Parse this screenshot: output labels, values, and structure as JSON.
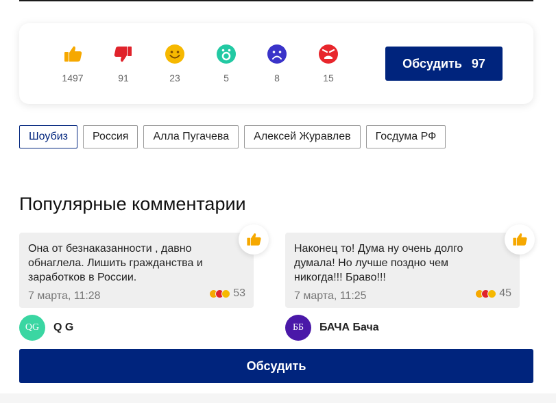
{
  "reactions": [
    {
      "name": "like",
      "icon": "thumbs-up-icon",
      "count": "1497",
      "color": "#f6a800"
    },
    {
      "name": "dislike",
      "icon": "thumbs-down-icon",
      "count": "91",
      "color": "#e0232b"
    },
    {
      "name": "smile",
      "icon": "smile-icon",
      "count": "23",
      "color": "#f6b800"
    },
    {
      "name": "surprise",
      "icon": "surprised-icon",
      "count": "5",
      "color": "#22c9a3"
    },
    {
      "name": "sad",
      "icon": "sad-icon",
      "count": "8",
      "color": "#3a33c9"
    },
    {
      "name": "angry",
      "icon": "angry-icon",
      "count": "15",
      "color": "#e8262c"
    }
  ],
  "discuss_top": {
    "label": "Обсудить",
    "count": "97"
  },
  "tags": [
    "Шоубиз",
    "Россия",
    "Алла Пугачева",
    "Алексей Журавлев",
    "Госдума РФ"
  ],
  "section_title": "Популярные комментарии",
  "comments": [
    {
      "text": "Она от безнаказанности , давно обнаглела. Лишить гражданства и заработков в России.",
      "date": "7 марта, 11:28",
      "score": "53",
      "author": "Q G",
      "initials": "QG",
      "avatar_color": "#3ad6a2"
    },
    {
      "text": "Наконец то! Дума ну очень долго думала! Но лучше поздно чем никогда!!! Браво!!!",
      "date": "7 марта, 11:25",
      "score": "45",
      "author": "БАЧА Бача",
      "initials": "ББ",
      "avatar_color": "#4a18a8"
    }
  ],
  "discuss_bottom": {
    "label": "Обсудить"
  },
  "colors": {
    "brand": "#00247d",
    "card_bg": "#efefef"
  }
}
